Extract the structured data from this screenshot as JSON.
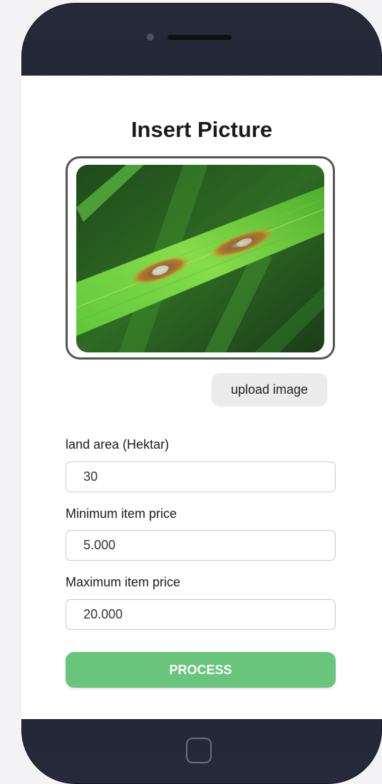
{
  "screen": {
    "title": "Insert Picture",
    "preview_image": "rice leaf with brown lesion spots",
    "upload_button": "upload image",
    "fields": [
      {
        "label": "land area (Hektar)",
        "value": "30"
      },
      {
        "label": "Minimum item price",
        "value": "5.000"
      },
      {
        "label": "Maximum item price",
        "value": "20.000"
      }
    ],
    "process_button": "PROCESS"
  },
  "colors": {
    "accent_green": "#68c57b",
    "phone_body": "#262a38",
    "upload_button_bg": "#ebebeb"
  },
  "icons": {
    "home": "home-button-icon",
    "camera": "front-camera-icon",
    "speaker": "speaker-icon"
  }
}
